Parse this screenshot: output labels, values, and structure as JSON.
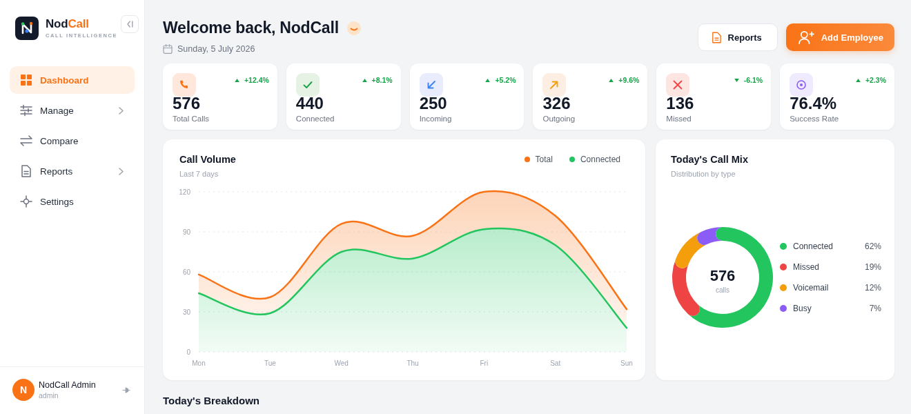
{
  "sidebar": {
    "brand": {
      "name": "Nod",
      "name_accent": "Call",
      "tagline": "CALL INTELLIGENCE"
    },
    "nav": [
      {
        "label": "Dashboard",
        "selected": true,
        "expandable": false
      },
      {
        "label": "Manage",
        "selected": false,
        "expandable": true
      },
      {
        "label": "Compare",
        "selected": false,
        "expandable": false
      },
      {
        "label": "Reports",
        "selected": false,
        "expandable": true
      },
      {
        "label": "Settings",
        "selected": false,
        "expandable": false
      }
    ],
    "user": {
      "initial": "N",
      "name": "NodCall Admin",
      "role": "admin"
    }
  },
  "header": {
    "title": "Welcome back, NodCall",
    "date": "Sunday, 5 July 2026",
    "buttons": [
      {
        "label": "Reports",
        "kind": "secondary"
      },
      {
        "label": "Add Employee",
        "kind": "primary"
      }
    ]
  },
  "stats": [
    {
      "value": "576",
      "label": "Total Calls",
      "change": "+12.4%",
      "rising": true,
      "color": "#ffe8db"
    },
    {
      "value": "440",
      "label": "Connected",
      "change": "+8.1%",
      "rising": true,
      "color": "#e6f2e4"
    },
    {
      "value": "250",
      "label": "Incoming",
      "change": "+5.2%",
      "rising": true,
      "color": "#e8ecfd"
    },
    {
      "value": "326",
      "label": "Outgoing",
      "change": "+9.6%",
      "rising": true,
      "color": "#fdeee3"
    },
    {
      "value": "136",
      "label": "Missed",
      "change": "-6.1%",
      "rising": false,
      "color": "#fde5e2"
    },
    {
      "value": "76.4%",
      "label": "Success Rate",
      "change": "+2.3%",
      "rising": true,
      "color": "#efeafd"
    }
  ],
  "call_volume": {
    "title": "Call Volume",
    "subtitle": "Last 7 days",
    "chart_data": {
      "type": "area",
      "categories": [
        "Mon",
        "Tue",
        "Wed",
        "Thu",
        "Fri",
        "Sat",
        "Sun"
      ],
      "series": [
        {
          "name": "Total",
          "color": "#f97316",
          "values": [
            58,
            41,
            96,
            87,
            120,
            102,
            32
          ]
        },
        {
          "name": "Connected",
          "color": "#22c55e",
          "values": [
            44,
            29,
            75,
            70,
            92,
            80,
            18
          ]
        }
      ],
      "ylim": [
        0,
        120
      ],
      "yticks": [
        0,
        30,
        60,
        90,
        120
      ],
      "grid": true
    }
  },
  "call_mix": {
    "title": "Today's Call Mix",
    "subtitle": "Distribution by type",
    "total": "576",
    "total_label": "calls",
    "chart_data": {
      "type": "donut",
      "categories": [
        "Connected",
        "Missed",
        "Voicemail",
        "Busy"
      ],
      "values": [
        62,
        19,
        12,
        7
      ]
    },
    "legend": [
      {
        "percent": "62%",
        "color": "#22c55e"
      },
      {
        "percent": "19%",
        "color": "#ef4444"
      },
      {
        "percent": "12%",
        "color": "#f59e0b"
      },
      {
        "percent": "7%",
        "color": "#8b5cf6"
      }
    ]
  },
  "breakdown": {
    "title": "Today's Breakdown"
  }
}
